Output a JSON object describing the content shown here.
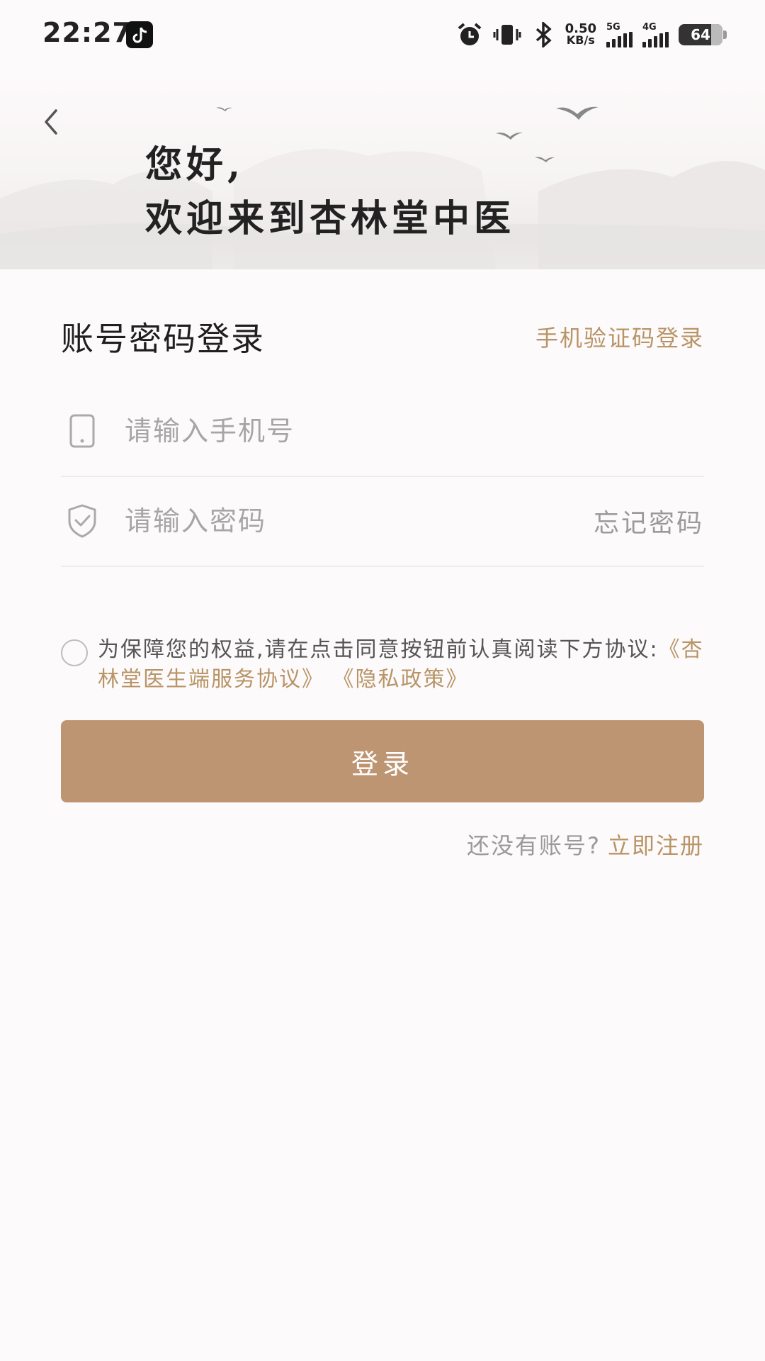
{
  "status_bar": {
    "time": "22:27",
    "net_speed_value": "0.50",
    "net_speed_unit": "KB/s",
    "signal1_label": "5G",
    "signal2_label": "4G",
    "battery": "64",
    "icons": [
      "tiktok-icon",
      "alarm-icon",
      "vibrate-icon",
      "bluetooth-icon"
    ]
  },
  "header": {
    "greeting_line1": "您好,",
    "greeting_line2": "欢迎来到杏林堂中医"
  },
  "login": {
    "title": "账号密码登录",
    "switch_label": "手机验证码登录",
    "phone_placeholder": "请输入手机号",
    "phone_value": "",
    "password_placeholder": "请输入密码",
    "password_value": "",
    "forgot_label": "忘记密码",
    "agreement_text": "为保障您的权益,请在点击同意按钮前认真阅读下方协议:",
    "agreement_link1": "《杏林堂医生端服务协议》",
    "agreement_link2": "《隐私政策》",
    "agreement_checked": false,
    "button_label": "登录",
    "no_account_text": "还没有账号?",
    "register_label": "立即注册"
  },
  "colors": {
    "accent": "#b89466",
    "button": "#bd9572",
    "background": "#fdfafb"
  }
}
